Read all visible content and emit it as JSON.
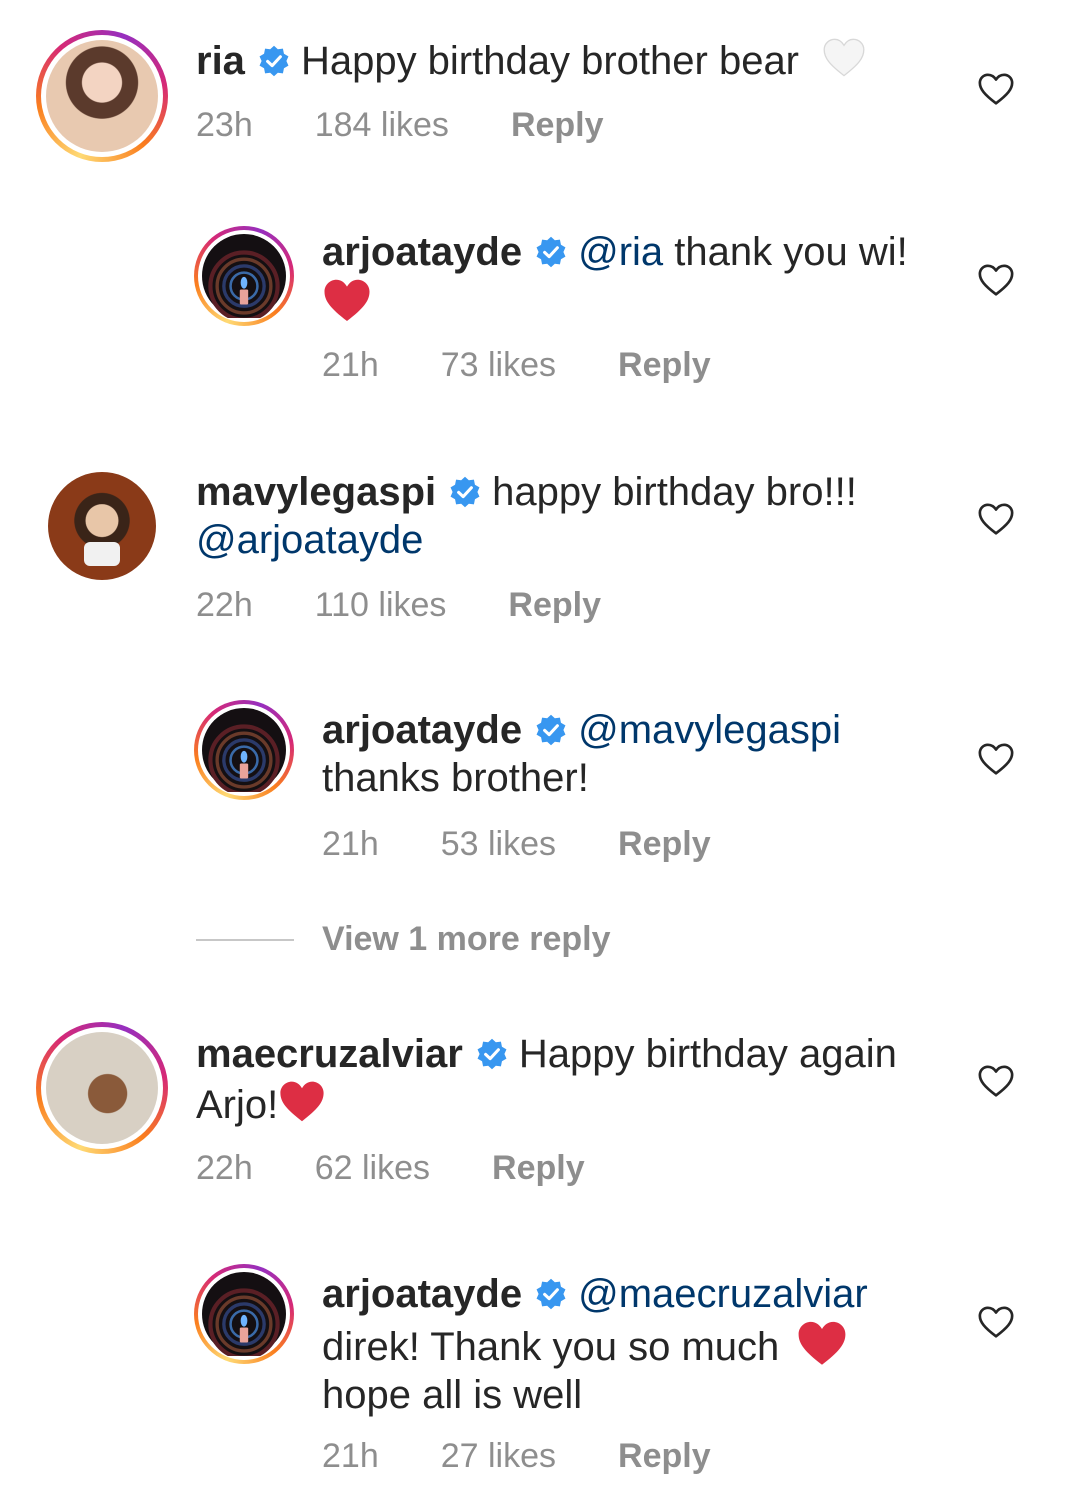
{
  "comments": [
    {
      "username": "ria",
      "text": "Happy birthday brother bear",
      "emoji": "🤍",
      "time": "23h",
      "likes": "184 likes",
      "reply": "Reply"
    },
    {
      "username": "arjoatayde",
      "mention": "@ria",
      "text": " thank you wi!",
      "time": "21h",
      "likes": "73 likes",
      "reply": "Reply"
    },
    {
      "username": "mavylegaspi",
      "text": "happy birthday bro!!!",
      "mention": "@arjoatayde",
      "time": "22h",
      "likes": "110 likes",
      "reply": "Reply"
    },
    {
      "username": "arjoatayde",
      "mention": "@mavylegaspi",
      "text": "thanks brother!",
      "time": "21h",
      "likes": "53 likes",
      "reply": "Reply"
    },
    {
      "username": "maecruzalviar",
      "text": "Happy birthday again",
      "text2": "Arjo!",
      "time": "22h",
      "likes": "62 likes",
      "reply": "Reply"
    },
    {
      "username": "arjoatayde",
      "mention": "@maecruzalviar",
      "text": "direk! Thank you so much",
      "text2": "hope all is well",
      "time": "21h",
      "likes": "27 likes",
      "reply": "Reply"
    }
  ],
  "view_more": "View 1 more reply",
  "colors": {
    "mention": "#00376b",
    "verified": "#3897f0",
    "heart_emoji": "#e0245e",
    "meta": "#8e8e8e"
  }
}
